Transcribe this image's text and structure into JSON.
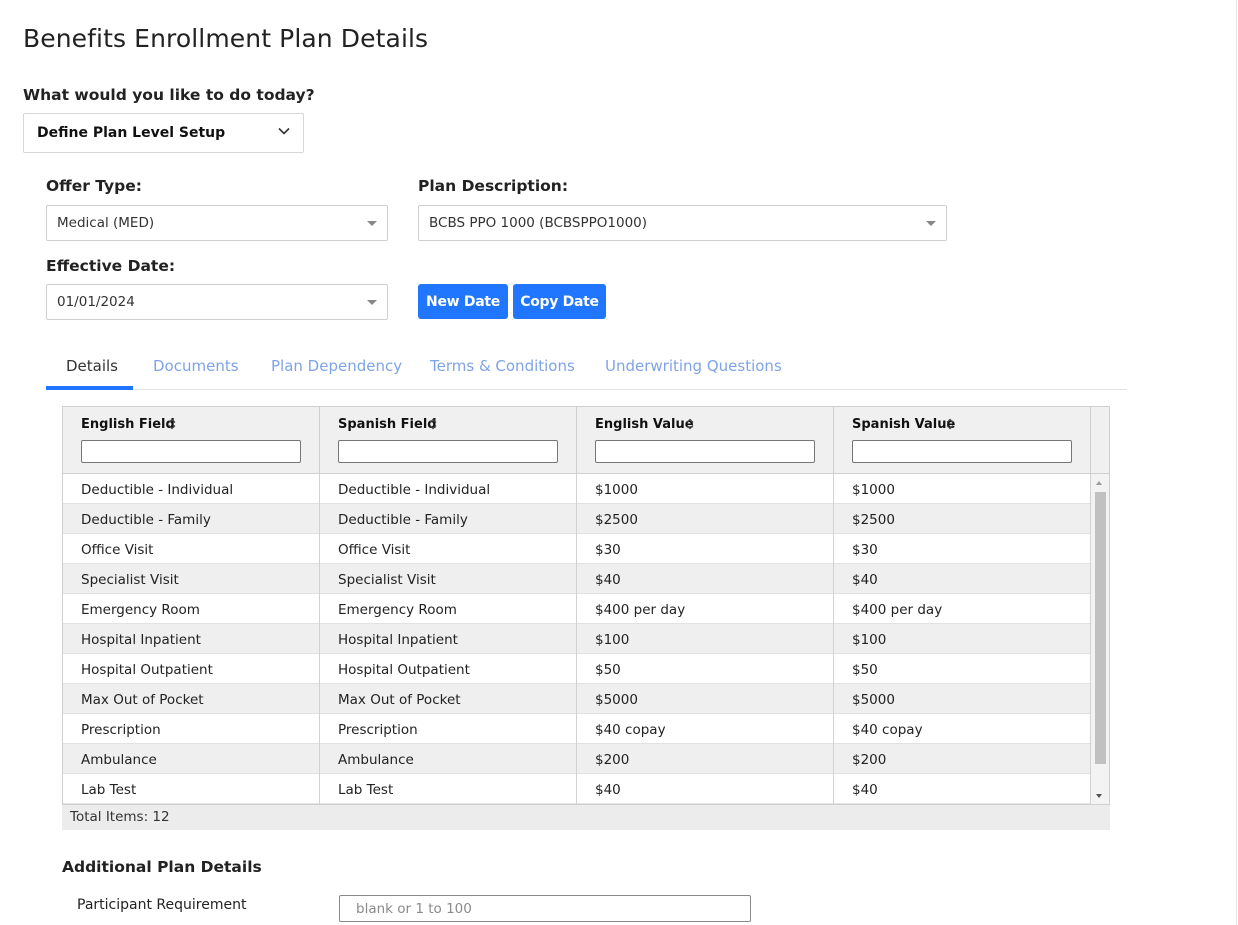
{
  "page": {
    "title": "Benefits Enrollment Plan Details"
  },
  "task": {
    "label": "What would you like to do today?",
    "selected": "Define Plan Level Setup"
  },
  "offer_type": {
    "label": "Offer Type:",
    "value": "Medical (MED)"
  },
  "plan_description": {
    "label": "Plan Description:",
    "value": "BCBS PPO 1000 (BCBSPPO1000)"
  },
  "effective_date": {
    "label": "Effective Date:",
    "value": "01/01/2024"
  },
  "buttons": {
    "new_date": "New Date",
    "copy_date": "Copy Date"
  },
  "tabs": [
    {
      "label": "Details",
      "active": true
    },
    {
      "label": "Documents",
      "active": false
    },
    {
      "label": "Plan Dependency",
      "active": false
    },
    {
      "label": "Terms & Conditions",
      "active": false
    },
    {
      "label": "Underwriting Questions",
      "active": false
    }
  ],
  "grid": {
    "columns": [
      "English Field",
      "Spanish Field",
      "English Value",
      "Spanish Value"
    ],
    "rows": [
      [
        "Deductible - Individual",
        "Deductible - Individual",
        "$1000",
        "$1000"
      ],
      [
        "Deductible - Family",
        "Deductible - Family",
        "$2500",
        "$2500"
      ],
      [
        "Office Visit",
        "Office Visit",
        "$30",
        "$30"
      ],
      [
        "Specialist Visit",
        "Specialist Visit",
        "$40",
        "$40"
      ],
      [
        "Emergency Room",
        "Emergency Room",
        "$400 per day",
        "$400 per day"
      ],
      [
        "Hospital Inpatient",
        "Hospital Inpatient",
        "$100",
        "$100"
      ],
      [
        "Hospital Outpatient",
        "Hospital Outpatient",
        "$50",
        "$50"
      ],
      [
        "Max Out of Pocket",
        "Max Out of Pocket",
        "$5000",
        "$5000"
      ],
      [
        "Prescription",
        "Prescription",
        "$40 copay",
        "$40 copay"
      ],
      [
        "Ambulance",
        "Ambulance",
        "$200",
        "$200"
      ],
      [
        "Lab Test",
        "Lab Test",
        "$40",
        "$40"
      ]
    ],
    "footer": "Total Items: 12"
  },
  "additional": {
    "title": "Additional Plan Details",
    "participant_label": "Participant Requirement",
    "participant_placeholder": "blank or 1 to 100"
  },
  "colors": {
    "primary": "#2176ff",
    "tab_inactive": "#7ea4e6",
    "row_alt": "#efefef"
  },
  "icons": {
    "task_select": "chevron-down-icon",
    "combo": "caret-down-icon",
    "sort": "sort-icon"
  }
}
